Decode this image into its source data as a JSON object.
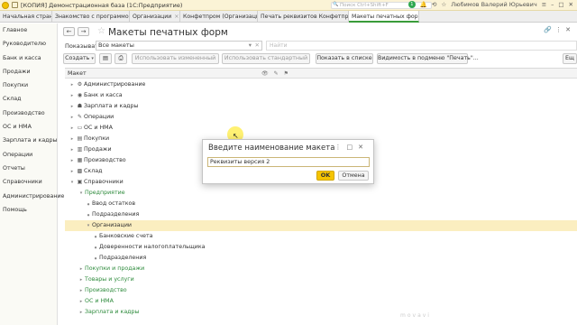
{
  "titlebar": {
    "title": "[КОПИЯ] Демонстрационная база  (1С:Предприятие)",
    "search_placeholder": "Поиск Ctrl+Shift+F",
    "user": "Любимов Валерий Юрьевич",
    "badge": "1"
  },
  "tabs": [
    {
      "label": "Начальная страница",
      "active": false
    },
    {
      "label": "Знакомство с программой",
      "active": false
    },
    {
      "label": "Организации",
      "active": false
    },
    {
      "label": "Конфетпром (Организация)",
      "active": false
    },
    {
      "label": "Печать реквизитов Конфетпром",
      "active": false
    },
    {
      "label": "Макеты печатных форм",
      "active": true
    }
  ],
  "sidebar": {
    "items": [
      "Главное",
      "Руководителю",
      "Банк и касса",
      "Продажи",
      "Покупки",
      "Склад",
      "Производство",
      "ОС и НМА",
      "Зарплата и кадры",
      "Операции",
      "Отчеты",
      "Справочники",
      "Администрирование",
      "Помощь"
    ]
  },
  "page": {
    "title": "Макеты печатных форм",
    "show_label": "Показывать:",
    "show_value": "Все макеты",
    "search_placeholder": "Найти"
  },
  "toolbar": {
    "create": "Создать",
    "use_changed": "Использовать измененный",
    "use_standard": "Использовать стандартный",
    "show_in_list": "Показать в списке",
    "visibility": "Видимость в подменю \"Печать\"..."
  },
  "grid": {
    "header": "Макет",
    "rows": [
      {
        "text": "Администрирование",
        "level": 0,
        "icon": "⚙",
        "green": false,
        "selected": false
      },
      {
        "text": "Банк и касса",
        "level": 0,
        "icon": "◉",
        "green": false,
        "selected": false
      },
      {
        "text": "Зарплата и кадры",
        "level": 0,
        "icon": "☗",
        "green": false,
        "selected": false
      },
      {
        "text": "Операции",
        "level": 0,
        "icon": "✎",
        "green": false,
        "selected": false
      },
      {
        "text": "ОС и НМА",
        "level": 0,
        "icon": "▭",
        "green": false,
        "selected": false
      },
      {
        "text": "Покупки",
        "level": 0,
        "icon": "▤",
        "green": false,
        "selected": false
      },
      {
        "text": "Продажи",
        "level": 0,
        "icon": "▥",
        "green": false,
        "selected": false
      },
      {
        "text": "Производство",
        "level": 0,
        "icon": "▦",
        "green": false,
        "selected": false
      },
      {
        "text": "Склад",
        "level": 0,
        "icon": "▩",
        "green": false,
        "selected": false
      },
      {
        "text": "Справочники",
        "level": 0,
        "icon": "▣",
        "green": false,
        "selected": false
      },
      {
        "text": "Предприятие",
        "level": 1,
        "icon": "",
        "green": true,
        "selected": false
      },
      {
        "text": "Ввод остатков",
        "level": 2,
        "icon": "",
        "green": false,
        "selected": false
      },
      {
        "text": "Подразделения",
        "level": 2,
        "icon": "",
        "green": false,
        "selected": false
      },
      {
        "text": "Организации",
        "level": 2,
        "icon": "",
        "green": false,
        "selected": true
      },
      {
        "text": "Банковские счета",
        "level": 3,
        "icon": "",
        "green": false,
        "selected": false
      },
      {
        "text": "Доверенности налогоплательщика",
        "level": 3,
        "icon": "",
        "green": false,
        "selected": false
      },
      {
        "text": "Подразделения",
        "level": 3,
        "icon": "",
        "green": false,
        "selected": false
      },
      {
        "text": "Покупки и продажи",
        "level": 1,
        "icon": "",
        "green": true,
        "selected": false
      },
      {
        "text": "Товары и услуги",
        "level": 1,
        "icon": "",
        "green": true,
        "selected": false
      },
      {
        "text": "Производство",
        "level": 1,
        "icon": "",
        "green": true,
        "selected": false
      },
      {
        "text": "ОС и НМА",
        "level": 1,
        "icon": "",
        "green": true,
        "selected": false
      },
      {
        "text": "Зарплата и кадры",
        "level": 1,
        "icon": "",
        "green": true,
        "selected": false
      }
    ]
  },
  "modal": {
    "title": "Введите наименование макета",
    "input_value": "Реквизиты версия 2",
    "ok": "OK",
    "cancel": "Отмена"
  },
  "watermark": "movavi"
}
